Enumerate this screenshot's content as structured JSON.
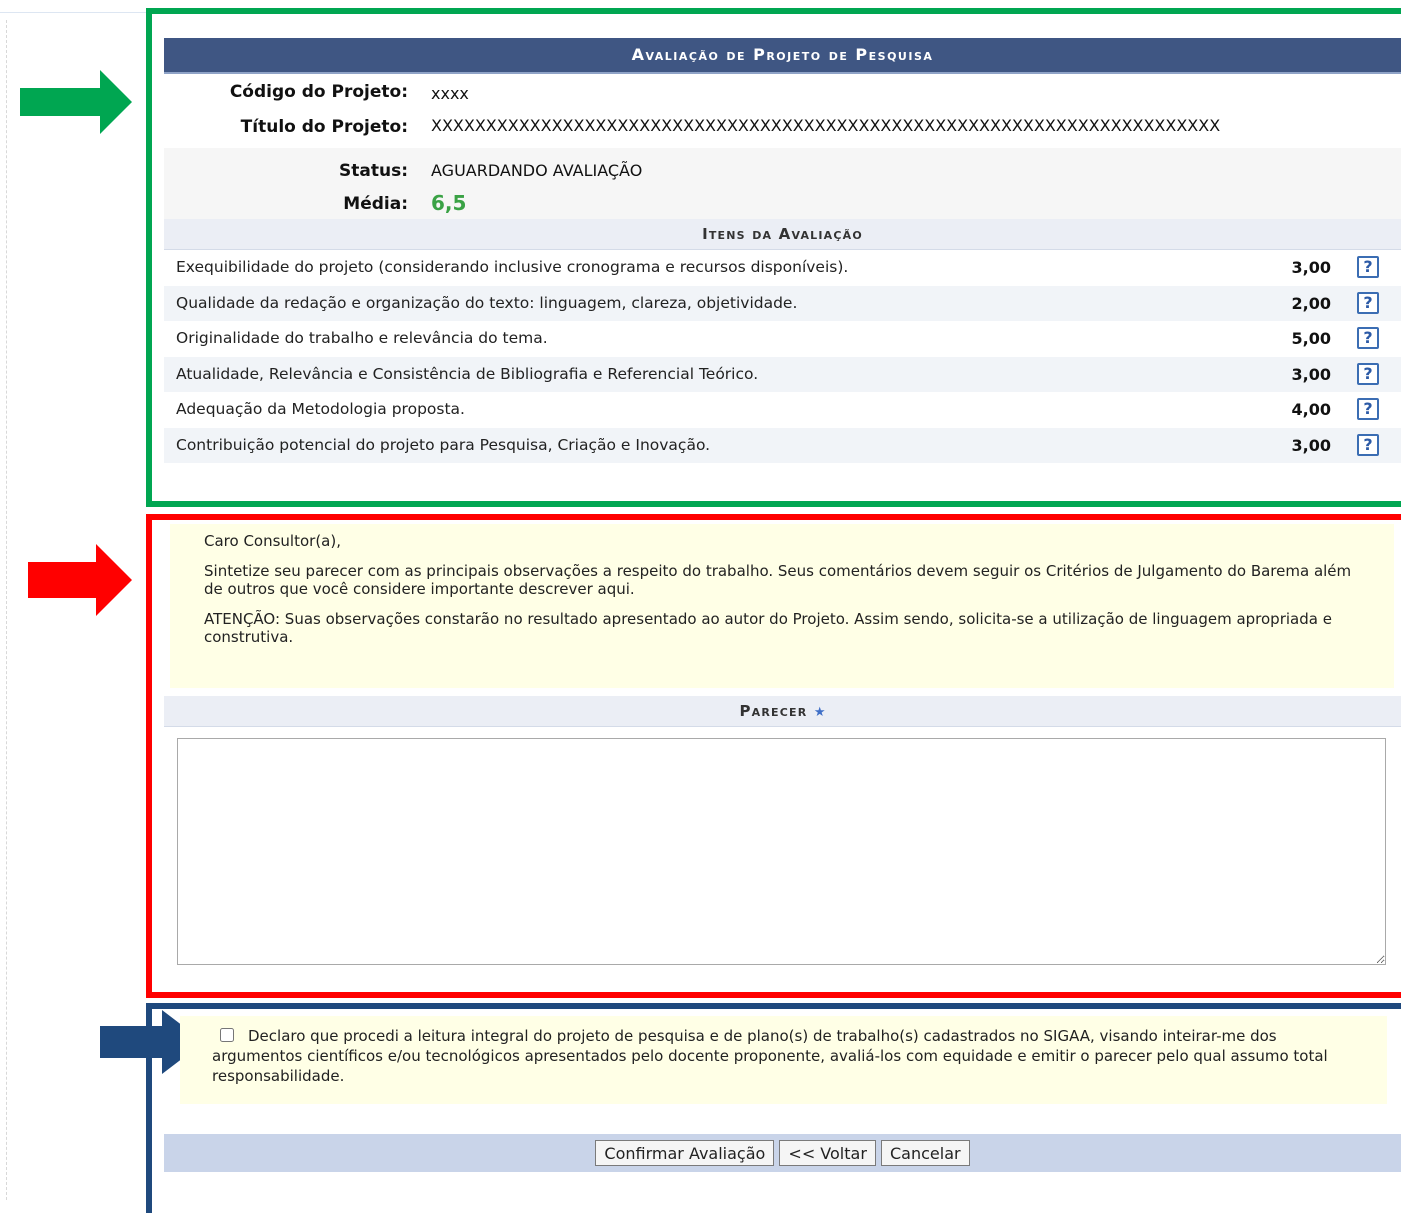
{
  "arrows": {
    "green_color": "#00a651",
    "red_color": "#ff0000",
    "navy_color": "#1f497d",
    "icon": "right-arrow-icon"
  },
  "form": {
    "title": "Avaliação de Projeto de Pesquisa",
    "fields": {
      "codigo_label": "Código do Projeto:",
      "codigo_value": "xxxx",
      "titulo_label": "Título do Projeto:",
      "titulo_value": "XXXXXXXXXXXXXXXXXXXXXXXXXXXXXXXXXXXXXXXXXXXXXXXXXXXXXXXXXXXXXXXXXXXXXXXX",
      "status_label": "Status:",
      "status_value": "AGUARDANDO AVALIAÇÃO",
      "media_label": "Média:",
      "media_value": "6,5",
      "media_color": "#3aa245"
    },
    "items_header": "Itens da Avaliação",
    "items": [
      {
        "desc": "Exequibilidade do projeto (considerando inclusive cronograma e recursos disponíveis).",
        "score": "3,00",
        "help": "?"
      },
      {
        "desc": "Qualidade da redação e organização do texto: linguagem, clareza, objetividade.",
        "score": "2,00",
        "help": "?"
      },
      {
        "desc": "Originalidade do trabalho e relevância do tema.",
        "score": "5,00",
        "help": "?"
      },
      {
        "desc": "Atualidade, Relevância e Consistência de Bibliografia e Referencial Teórico.",
        "score": "3,00",
        "help": "?"
      },
      {
        "desc": "Adequação da Metodologia proposta.",
        "score": "4,00",
        "help": "?"
      },
      {
        "desc": "Contribuição potencial do projeto para Pesquisa, Criação e Inovação.",
        "score": "3,00",
        "help": "?"
      }
    ]
  },
  "note": {
    "greeting": "Caro Consultor(a),",
    "paragraph1": "Sintetize seu parecer com as principais observações a respeito do trabalho. Seus comentários devem seguir os Critérios de Julgamento do Barema além de outros que você considere importante descrever aqui.",
    "paragraph2": "ATENÇÃO: Suas observações constarão no resultado apresentado ao autor do Projeto. Assim sendo, solicita-se a utilização de linguagem apropriada e construtiva."
  },
  "parecer": {
    "header": "Parecer",
    "required_mark": "★",
    "value": ""
  },
  "declaration": {
    "checked": false,
    "text": "Declaro que procedi a leitura integral do projeto de pesquisa e de plano(s) de trabalho(s) cadastrados no SIGAA, visando inteirar-me dos argumentos científicos e/ou tecnológicos apresentados pelo docente proponente, avaliá-los com equidade e emitir o parecer pelo qual assumo total responsabilidade."
  },
  "buttons": {
    "confirm": "Confirmar Avaliação",
    "back": "<< Voltar",
    "cancel": "Cancelar"
  }
}
